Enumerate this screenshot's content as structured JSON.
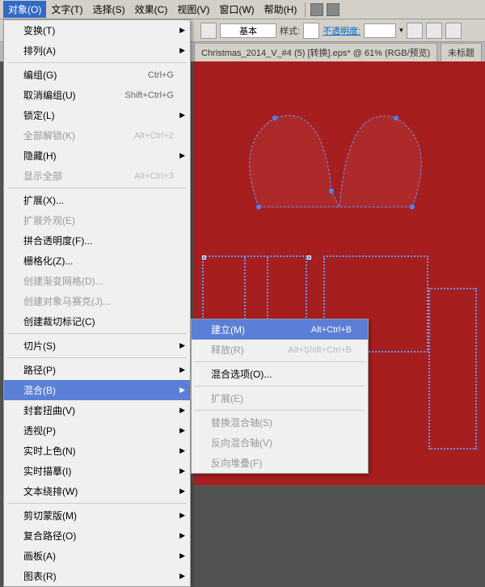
{
  "menubar": {
    "items": [
      "对象(O)",
      "文字(T)",
      "选择(S)",
      "效果(C)",
      "视图(V)",
      "窗口(W)",
      "帮助(H)"
    ]
  },
  "toolbar": {
    "basic": "基本",
    "style_label": "样式:",
    "opacity": "不透明度:"
  },
  "tabs": {
    "main": "Christmas_2014_V_#4 (5) [转换].eps* @ 61% (RGB/预览)",
    "untitled": "未标题"
  },
  "menu": {
    "items": [
      {
        "label": "变换(T)",
        "sub": true
      },
      {
        "label": "排列(A)",
        "sub": true
      },
      {
        "sep": true
      },
      {
        "label": "编组(G)",
        "shortcut": "Ctrl+G"
      },
      {
        "label": "取消编组(U)",
        "shortcut": "Shift+Ctrl+G"
      },
      {
        "label": "锁定(L)",
        "sub": true
      },
      {
        "label": "全部解锁(K)",
        "shortcut": "Alt+Ctrl+2",
        "disabled": true
      },
      {
        "label": "隐藏(H)",
        "sub": true
      },
      {
        "label": "显示全部",
        "shortcut": "Alt+Ctrl+3",
        "disabled": true
      },
      {
        "sep": true
      },
      {
        "label": "扩展(X)..."
      },
      {
        "label": "扩展外观(E)",
        "disabled": true
      },
      {
        "label": "拼合透明度(F)..."
      },
      {
        "label": "栅格化(Z)..."
      },
      {
        "label": "创建渐变网格(D)...",
        "disabled": true
      },
      {
        "label": "创建对象马赛克(J)...",
        "disabled": true
      },
      {
        "label": "创建裁切标记(C)"
      },
      {
        "sep": true
      },
      {
        "label": "切片(S)",
        "sub": true
      },
      {
        "sep": true
      },
      {
        "label": "路径(P)",
        "sub": true
      },
      {
        "label": "混合(B)",
        "sub": true,
        "highlighted": true
      },
      {
        "label": "封套扭曲(V)",
        "sub": true
      },
      {
        "label": "透视(P)",
        "sub": true
      },
      {
        "label": "实时上色(N)",
        "sub": true
      },
      {
        "label": "实时描摹(I)",
        "sub": true
      },
      {
        "label": "文本绕排(W)",
        "sub": true
      },
      {
        "sep": true
      },
      {
        "label": "剪切蒙版(M)",
        "sub": true
      },
      {
        "label": "复合路径(O)",
        "sub": true
      },
      {
        "label": "画板(A)",
        "sub": true
      },
      {
        "label": "图表(R)",
        "sub": true
      }
    ]
  },
  "submenu": {
    "items": [
      {
        "label": "建立(M)",
        "shortcut": "Alt+Ctrl+B",
        "highlighted": true
      },
      {
        "label": "释放(R)",
        "shortcut": "Alt+Shift+Ctrl+B",
        "disabled": true
      },
      {
        "sep": true
      },
      {
        "label": "混合选项(O)..."
      },
      {
        "sep": true
      },
      {
        "label": "扩展(E)",
        "disabled": true
      },
      {
        "sep": true
      },
      {
        "label": "替换混合轴(S)",
        "disabled": true
      },
      {
        "label": "反向混合轴(V)",
        "disabled": true
      },
      {
        "label": "反向堆叠(F)",
        "disabled": true
      }
    ]
  }
}
